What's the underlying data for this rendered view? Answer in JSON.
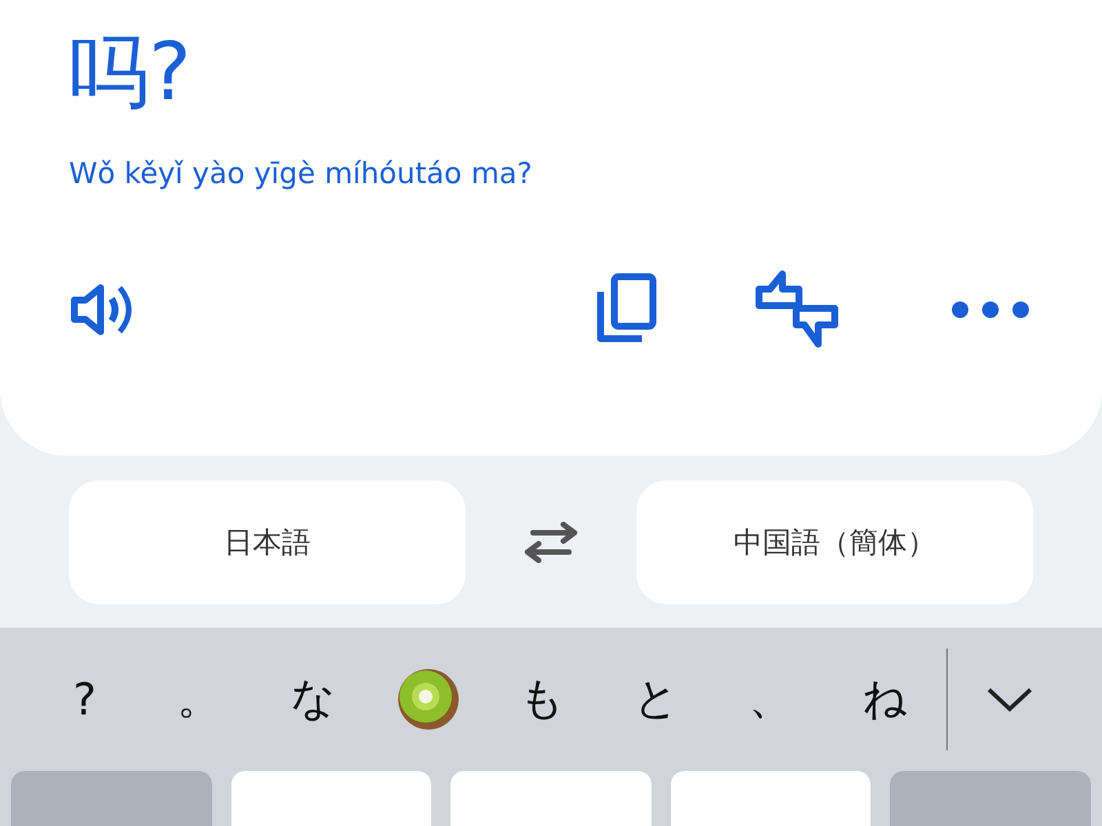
{
  "translation": {
    "text": "吗?",
    "romanization": "Wǒ kěyǐ yào yīgè míhóutáo ma?"
  },
  "actions": [
    {
      "kind": "speaker"
    },
    {
      "kind": "copy"
    },
    {
      "kind": "feedback"
    },
    {
      "kind": "more"
    }
  ],
  "languages": {
    "source": "日本語",
    "target": "中国語（簡体）"
  },
  "suggestions": [
    {
      "kind": "text",
      "text": "?"
    },
    {
      "kind": "text",
      "text": "。"
    },
    {
      "kind": "text",
      "text": "な"
    },
    {
      "kind": "emoji"
    },
    {
      "kind": "text",
      "text": "も"
    },
    {
      "kind": "text",
      "text": "と"
    },
    {
      "kind": "text",
      "text": "、"
    },
    {
      "kind": "text",
      "text": "ね"
    }
  ],
  "keys": [
    {
      "kind": "function"
    },
    {
      "kind": "letter"
    },
    {
      "kind": "letter"
    },
    {
      "kind": "letter"
    },
    {
      "kind": "function"
    }
  ]
}
